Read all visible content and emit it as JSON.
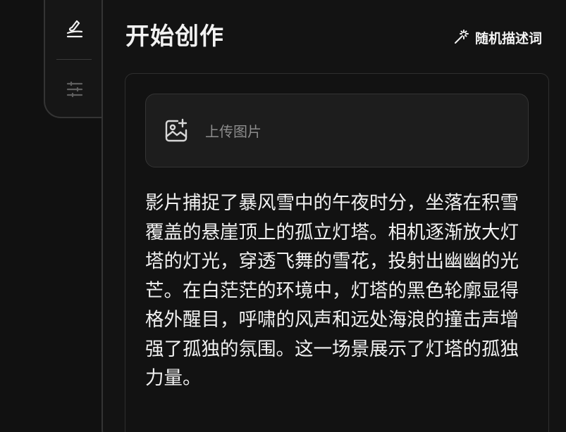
{
  "header": {
    "title": "开始创作",
    "random_button_label": "随机描述词"
  },
  "sidebar": {
    "items": [
      {
        "id": "create",
        "icon": "brush-icon",
        "active": true
      },
      {
        "id": "settings",
        "icon": "sliders-icon",
        "active": false
      }
    ]
  },
  "upload": {
    "label": "上传图片",
    "icon": "image-plus-icon"
  },
  "prompt": {
    "text": "影片捕捉了暴风雪中的午夜时分，坐落在积雪覆盖的悬崖顶上的孤立灯塔。相机逐渐放大灯塔的灯光，穿透飞舞的雪花，投射出幽幽的光芒。在白茫茫的环境中，灯塔的黑色轮廓显得格外醒目，呼啸的风声和远处海浪的撞击声增强了孤独的氛围。这一场景展示了灯塔的孤独力量。"
  },
  "colors": {
    "background": "#111111",
    "panel_border": "#343434",
    "text_primary": "#f2f2f2",
    "text_muted": "#8d8d8d",
    "upload_bg": "#1d1d1d"
  }
}
